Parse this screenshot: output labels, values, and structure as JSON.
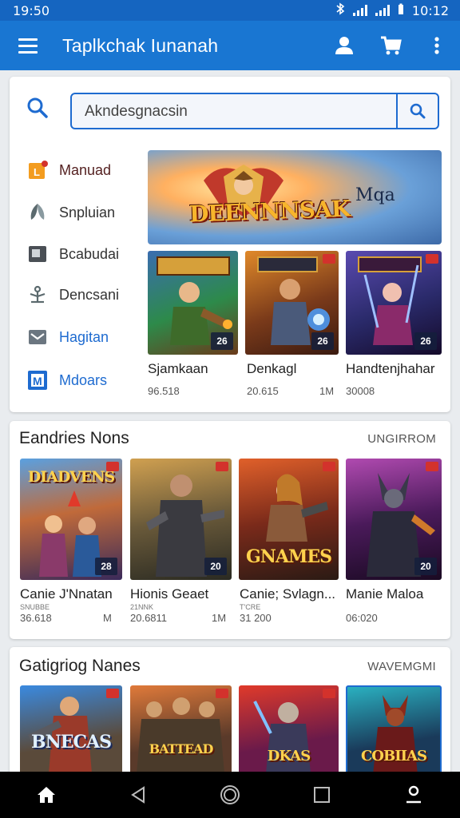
{
  "status_bar": {
    "time": "19:50",
    "clock": "10:12"
  },
  "app_bar": {
    "title": "Taplkchak Iunanah"
  },
  "search": {
    "value": "Akndesgnacsin"
  },
  "sidebar": {
    "items": [
      {
        "label": "Manuad"
      },
      {
        "label": "Snpluian"
      },
      {
        "label": "Bcabudai"
      },
      {
        "label": "Dencsani"
      },
      {
        "label": "Hagitan"
      },
      {
        "label": "Mdoars"
      }
    ]
  },
  "banner": {
    "title": "DEENNNSAK",
    "subtitle": "Mqa"
  },
  "featured": [
    {
      "name": "Sjamkaan",
      "meta": "96.518",
      "count": "26"
    },
    {
      "name": "Denkagl",
      "meta": "20.615",
      "extra": "1M",
      "count": "26"
    },
    {
      "name": "Handtenjhahar",
      "meta": "30008",
      "count": "26"
    }
  ],
  "section2": {
    "title": "Eandries Nons",
    "link": "UNGIRROM",
    "games": [
      {
        "name": "Canie J'Nnatan",
        "sub": "SNUBBE",
        "meta": "36.618",
        "extra": "M",
        "count": "28",
        "logo": "DIADVENS"
      },
      {
        "name": "Hionis Geaet",
        "sub": "21NNK",
        "meta": "20.6811",
        "extra": "1M",
        "count": "20"
      },
      {
        "name": "Canie; Svlagn...",
        "sub": "T'CRE",
        "meta": "31 200",
        "logo": "GNAMES"
      },
      {
        "name": "Manie Maloa",
        "meta": "06:020",
        "count": "20"
      }
    ]
  },
  "section3": {
    "title": "Gatigriog Nanes",
    "link": "WAVEMGMI",
    "logos": [
      "BNECAS",
      "BATTEAD",
      "DKAS",
      "COBIIAS"
    ]
  },
  "colors": {
    "primary": "#1976d2",
    "accent": "#1e6bd0",
    "badge_red": "#d3322c"
  },
  "icons": [
    "menu-icon",
    "account-icon",
    "cart-icon",
    "more-vert-icon",
    "search-icon",
    "home-icon",
    "back-icon",
    "circle-home-icon",
    "recents-icon",
    "profile-icon"
  ]
}
